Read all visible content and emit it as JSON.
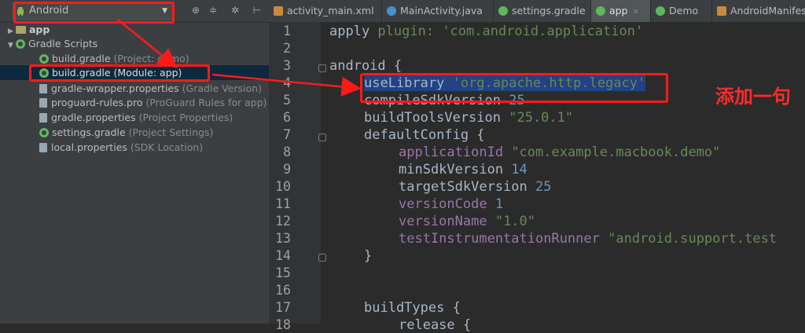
{
  "project_selector": {
    "label": "Android"
  },
  "tree": {
    "items": [
      {
        "name": "app",
        "secondary": ""
      },
      {
        "name": "Gradle Scripts",
        "secondary": ""
      },
      {
        "name": "build.gradle",
        "secondary": "(Project: demo)"
      },
      {
        "name": "build.gradle (Module: app)",
        "secondary": ""
      },
      {
        "name": "gradle-wrapper.properties",
        "secondary": "(Gradle Version)"
      },
      {
        "name": "proguard-rules.pro",
        "secondary": "(ProGuard Rules for app)"
      },
      {
        "name": "gradle.properties",
        "secondary": "(Project Properties)"
      },
      {
        "name": "settings.gradle",
        "secondary": "(Project Settings)"
      },
      {
        "name": "local.properties",
        "secondary": "(SDK Location)"
      }
    ]
  },
  "tabs": [
    {
      "label": "activity_main.xml"
    },
    {
      "label": "MainActivity.java"
    },
    {
      "label": "settings.gradle"
    },
    {
      "label": "app"
    },
    {
      "label": "Demo"
    },
    {
      "label": "AndroidManifest."
    }
  ],
  "line_numbers": [
    "1",
    "2",
    "3",
    "4",
    "5",
    "6",
    "7",
    "8",
    "9",
    "10",
    "11",
    "12",
    "13",
    "14",
    "15",
    "16",
    "17",
    "18"
  ],
  "code": {
    "l1_kw": "apply ",
    "l1_prop": "plugin: ",
    "l1_str": "'com.android.application'",
    "l3": "android {",
    "l4_kw": "useLibrary ",
    "l4_str": "'org.apache.http.legacy'",
    "l5_kw": "compileSdkVersion ",
    "l5_num": "25",
    "l6_kw": "buildToolsVersion ",
    "l6_str": "\"25.0.1\"",
    "l7": "defaultConfig {",
    "l8_prop": "applicationId ",
    "l8_str": "\"com.example.macbook.demo\"",
    "l9_kw": "minSdkVersion ",
    "l9_num": "14",
    "l10_kw": "targetSdkVersion ",
    "l10_num": "25",
    "l11_prop": "versionCode ",
    "l11_num": "1",
    "l12_prop": "versionName ",
    "l12_str": "\"1.0\"",
    "l13_prop": "testInstrumentationRunner ",
    "l13_str": "\"android.support.test",
    "l14": "}",
    "l17": "buildTypes {",
    "l18": "release {"
  },
  "annotation": {
    "text": "添加一句"
  },
  "colors": {
    "annotation": "#ff1a1a",
    "selection": "#214283",
    "string": "#6a8759",
    "number": "#6897bb",
    "property": "#9876aa"
  }
}
